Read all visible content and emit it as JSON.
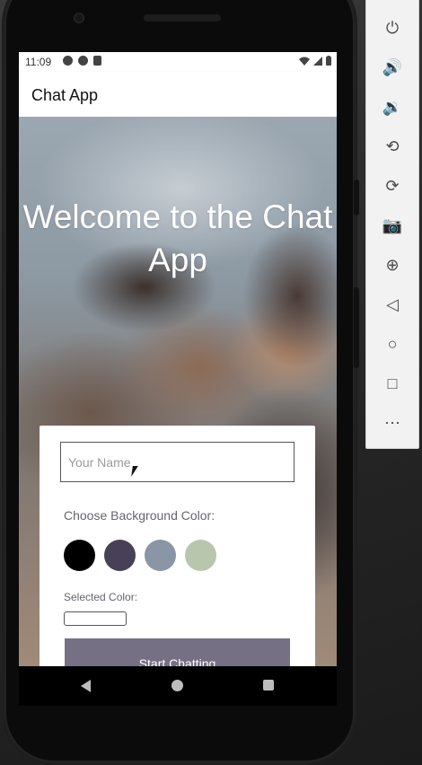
{
  "status_bar": {
    "time": "11:09"
  },
  "app_bar": {
    "title": "Chat App"
  },
  "welcome": {
    "title": "Welcome to the Chat App"
  },
  "form": {
    "name_input": {
      "placeholder": "Your Name",
      "value": ""
    },
    "choose_color_label": "Choose Background Color:",
    "colors": [
      "#000000",
      "#474056",
      "#8A95A5",
      "#B9C6AE"
    ],
    "selected_color_label": "Selected Color:",
    "start_button": {
      "label": "Start Chatting",
      "color": "#757083"
    }
  },
  "emulator_toolbar": {
    "buttons": [
      {
        "icon": "power-icon",
        "glyph": "⏻"
      },
      {
        "icon": "volume-up-icon",
        "glyph": "🔊"
      },
      {
        "icon": "volume-down-icon",
        "glyph": "🔉"
      },
      {
        "icon": "rotate-left-icon",
        "glyph": "⟲"
      },
      {
        "icon": "rotate-right-icon",
        "glyph": "⟳"
      },
      {
        "icon": "camera-icon",
        "glyph": "📷"
      },
      {
        "icon": "zoom-icon",
        "glyph": "⊕"
      },
      {
        "icon": "back-icon",
        "glyph": "◁"
      },
      {
        "icon": "home-icon",
        "glyph": "○"
      },
      {
        "icon": "overview-icon",
        "glyph": "□"
      },
      {
        "icon": "more-icon",
        "glyph": "⋯"
      }
    ]
  }
}
